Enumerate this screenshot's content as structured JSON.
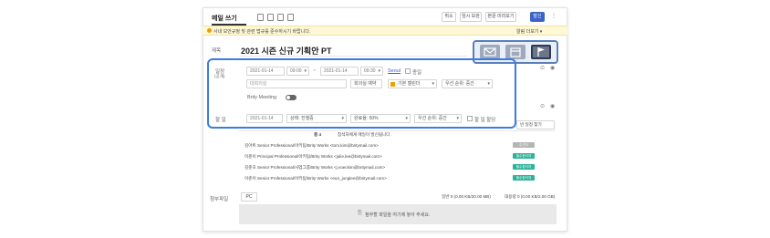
{
  "header": {
    "title": "메일 쓰기",
    "buttons": [
      "취소",
      "임시 보관",
      "본문 미리보기",
      "발신"
    ]
  },
  "notice": {
    "text": "사내 보안규정 및 관련 법규를 준수하시기 바랍니다.",
    "more": "알림 더보기 ▾"
  },
  "subject": {
    "label": "제목",
    "value": "2021 시즌 신규 기획안 PT"
  },
  "schedule": {
    "label": "일정",
    "sub_label": "(공개)",
    "start_date": "2021-01-14",
    "start_time": "09:00",
    "end_date": "2021-01-14",
    "end_time": "09:30",
    "timezone": "Seoul",
    "allday_label": "종일",
    "room_placeholder": "대회의실",
    "room_button": "회의실 예약",
    "calendar": "기본 캘린더",
    "priority": "우선 순위: 중간",
    "meeting_label": "Brity Meeting"
  },
  "todo": {
    "label": "할 일",
    "due_date": "2021-01-14",
    "status": "상태: 진행중",
    "progress": "완료율: 50%",
    "priority": "우선 순위: 중간",
    "assign_label": "할 일 할당"
  },
  "recipients": {
    "find_button": "빈 일정 찾기",
    "header_count": "총 4",
    "header_text": "참석자에게 메일이 발신됩니다.",
    "rows": [
      {
        "text": "김아트 Senior Professional/아키팀/Brity Works <tom.kim@britymail.com>",
        "badge": "주관자",
        "badge_color": "#b5b5b5"
      },
      {
        "text": "이준이 Principal Professional/아키팀/Brity Works <julie.lee@britymail.com>",
        "badge": "필수참석자",
        "badge_color": "#2bb39a"
      },
      {
        "text": "김준호 Senior Professional/사업그룹/Brity Works <j.voeckim@britymail.com>",
        "badge": "필수참석자",
        "badge_color": "#2bb39a"
      },
      {
        "text": "이준이 Senior Professional/아키팀/Brity Works <eun_junglee@britymail.com>",
        "badge": "필수참석자",
        "badge_color": "#2bb39a"
      }
    ]
  },
  "attachments": {
    "label": "첨부파일",
    "pc_button": "PC",
    "normal": "일반 0 (0.00 KB/20.00 MB)",
    "large": "대용량 0 (0.00 KB/2.00 GB)",
    "drop_text": "첨부할 파일을 여기에 놓아 주세요."
  },
  "floating_toolbar": {
    "icons": [
      "mail-icon",
      "calendar-icon",
      "flag-icon"
    ]
  },
  "colors": {
    "accent": "#3b63c9",
    "highlight": "#3d7be3",
    "badge_green": "#2bb39a",
    "notice_bg": "#fff8d6"
  }
}
